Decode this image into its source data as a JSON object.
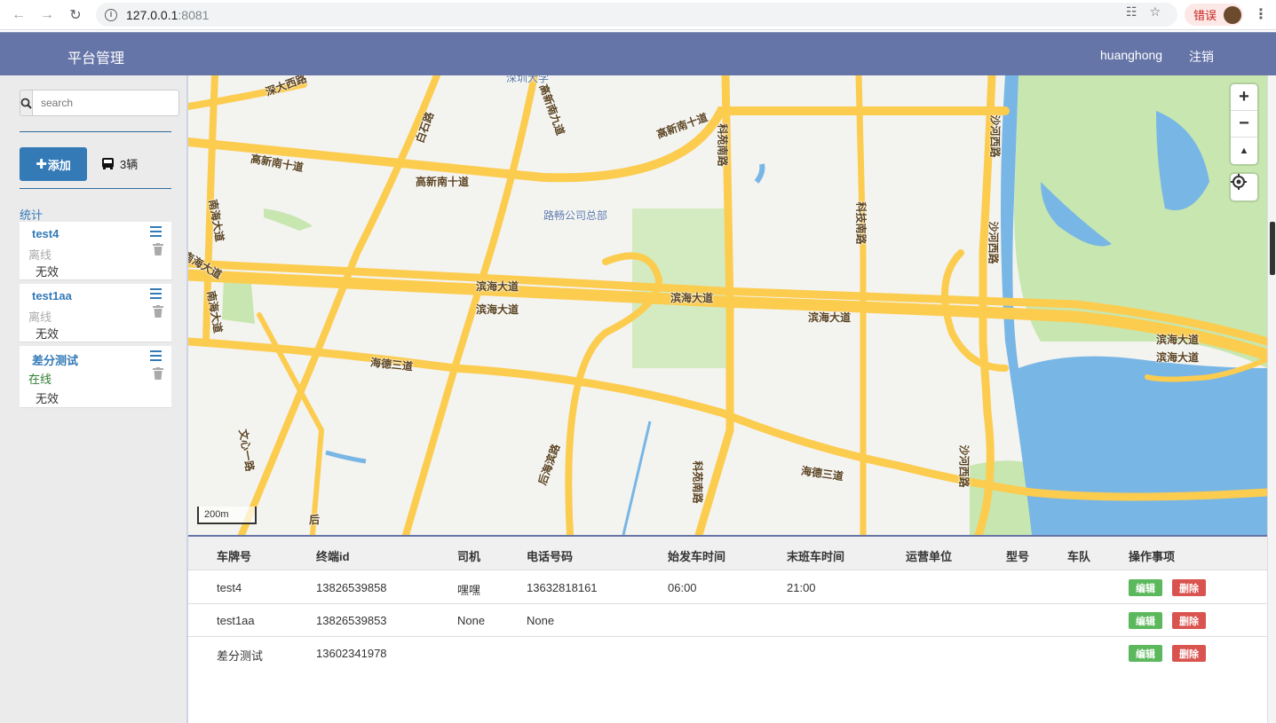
{
  "browser": {
    "url_host": "127.0.0.1",
    "url_port": ":8081",
    "error_chip": "错误"
  },
  "header": {
    "brand": "平台管理",
    "username": "huanghong",
    "logout": "注销"
  },
  "sidebar": {
    "search_placeholder": "search",
    "add_button": "添加",
    "vehicle_count": "3辆",
    "stats_link": "统计",
    "vehicles": [
      {
        "name": "test4",
        "status": "离线",
        "validity": "无效"
      },
      {
        "name": "test1aa",
        "status": "离线",
        "validity": "无效"
      },
      {
        "name": "差分测试",
        "status": "在线",
        "validity": "无效"
      }
    ]
  },
  "map": {
    "scale": "200m",
    "labels": {
      "shenda_west": "深大西路",
      "gaoxin_s10_a": "高新南十道",
      "gaoxin_s10_b": "高新南十道",
      "gaoxin_s10_c": "高新南十道",
      "baishi": "白石路",
      "gaoxin_s9": "高新南九道",
      "shenzhen_univ": "深圳大学",
      "keyuan_n": "科苑南路",
      "keji_n": "科技南路",
      "shahe_w1": "沙河西路",
      "shahe_w2": "沙河西路",
      "shahe_w3": "沙河西路",
      "nanhai_1": "南海大道",
      "nanhai_2": "南海大道",
      "nanhai_3": "南海大道",
      "lcgs": "路畅公司总部",
      "binhai_1": "滨海大道",
      "binhai_2": "滨海大道",
      "binhai_3": "滨海大道",
      "binhai_4": "滨海大道",
      "binhai_5": "滨海大道",
      "binhai_6": "滨海大道",
      "haide_3a": "海德三道",
      "haide_3b": "海德三道",
      "wenxin_1": "文心一路",
      "houhai": "后海滨路",
      "keyuan_s": "科苑南路",
      "hou": "后"
    }
  },
  "table": {
    "headers": [
      "车牌号",
      "终端id",
      "司机",
      "电话号码",
      "始发车时间",
      "末班车时间",
      "运营单位",
      "型号",
      "车队",
      "操作事项"
    ],
    "edit_label": "编辑",
    "delete_label": "删除",
    "rows": [
      {
        "plate": "test4",
        "terminal": "13826539858",
        "driver": "嘿嘿",
        "phone": "13632818161",
        "first": "06:00",
        "last": "21:00"
      },
      {
        "plate": "test1aa",
        "terminal": "13826539853",
        "driver": "None",
        "phone": "None",
        "first": "",
        "last": ""
      },
      {
        "plate": "差分测试",
        "terminal": "13602341978",
        "driver": "",
        "phone": "",
        "first": "",
        "last": ""
      }
    ]
  },
  "colors": {
    "header_bg": "#6675a8",
    "primary": "#337ab7",
    "road": "#fccc4f",
    "park": "#c8e6b0",
    "water": "#78b6e6",
    "edit_btn": "#5cb85c",
    "delete_btn": "#d9534f"
  }
}
